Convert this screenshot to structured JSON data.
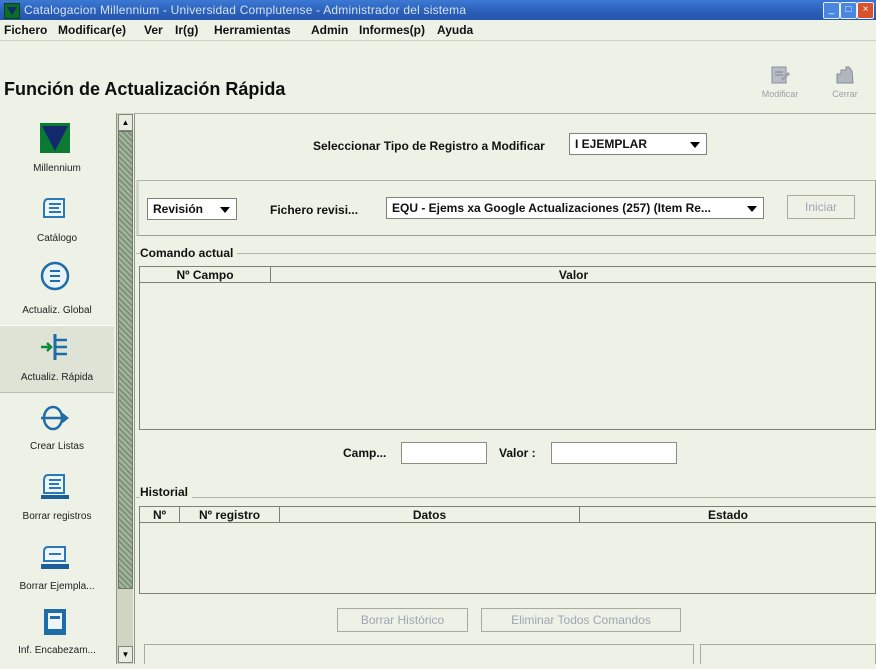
{
  "window": {
    "title": "Catalogacion Millennium - Universidad Complutense - Administrador del sistema",
    "controls": [
      "minimize",
      "maximize",
      "close"
    ]
  },
  "menubar": [
    {
      "label": "Fichero"
    },
    {
      "label": "Modificar(e)"
    },
    {
      "label": "Ver"
    },
    {
      "label": "Ir(g)"
    },
    {
      "label": "Herramientas"
    },
    {
      "label": "Admin"
    },
    {
      "label": "Informes(p)"
    },
    {
      "label": "Ayuda"
    }
  ],
  "header": {
    "title": "Función de Actualización Rápida",
    "buttons": [
      {
        "label": "Modificar",
        "icon": "edit-note-icon",
        "enabled": false
      },
      {
        "label": "Cerrar",
        "icon": "close-hand-icon",
        "enabled": false
      }
    ]
  },
  "nav": {
    "items": [
      {
        "label": "Millennium",
        "icon": "millennium-logo-icon"
      },
      {
        "label": "Catálogo",
        "icon": "catalog-icon"
      },
      {
        "label": "Actualiz. Global",
        "icon": "global-update-icon"
      },
      {
        "label": "Actualiz. Rápida",
        "icon": "rapid-update-icon",
        "selected": true
      },
      {
        "label": "Crear Listas",
        "icon": "create-lists-icon"
      },
      {
        "label": "Borrar registros",
        "icon": "delete-records-icon"
      },
      {
        "label": "Borrar Ejempla...",
        "icon": "delete-items-icon"
      },
      {
        "label": "Inf. Encabezam...",
        "icon": "headings-report-icon"
      }
    ]
  },
  "form": {
    "record_type_label": "Seleccionar Tipo de Registro a Modificar",
    "record_type_value": "I EJEMPLAR",
    "mode_value": "Revisión",
    "file_label": "Fichero revisi...",
    "file_value": "EQU - Ejems xa Google Actualizaciones (257) (Item Re...",
    "start_button": "Iniciar"
  },
  "current_command": {
    "label": "Comando actual",
    "columns": [
      "Nº Campo",
      "Valor"
    ],
    "rows": [],
    "field_label": "Camp...",
    "field_value": "",
    "value_label": "Valor :",
    "value_value": ""
  },
  "history": {
    "label": "Historial",
    "columns": [
      "Nº",
      "Nº registro",
      "Datos",
      "Estado"
    ],
    "rows": []
  },
  "footer_buttons": {
    "clear_history": "Borrar Histórico",
    "remove_commands": "Eliminar Todos Comandos"
  },
  "colors": {
    "titlebar": "#2a5fb8",
    "background": "#eef1e6",
    "disabled_text": "#9ea7b3",
    "scroll_thumb": "#8c9e86"
  }
}
